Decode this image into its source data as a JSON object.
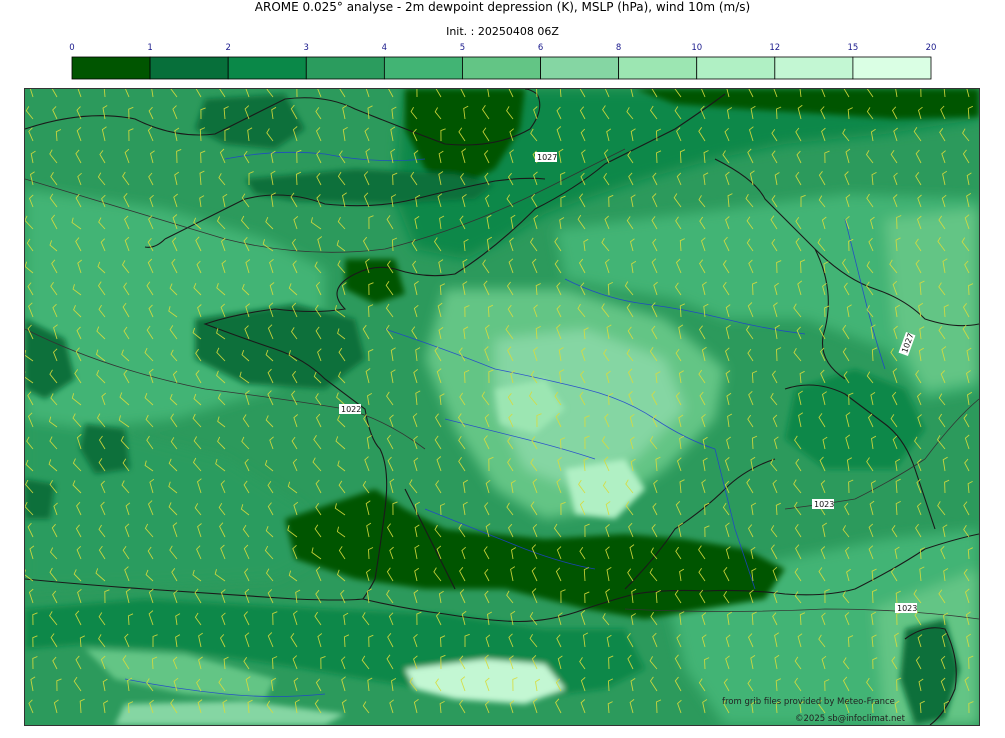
{
  "header": {
    "title": "AROME 0.025° analyse - 2m dewpoint depression (K), MSLP (hPa), wind 10m (m/s)",
    "subtitle": "Init. : 20250408 06Z"
  },
  "legend": {
    "ticks": [
      "0",
      "1",
      "2",
      "3",
      "4",
      "5",
      "6",
      "8",
      "10",
      "12",
      "15",
      "20"
    ],
    "colors": [
      "#005500",
      "#076f3a",
      "#0a8848",
      "#2b9c5e",
      "#42b474",
      "#63c585",
      "#85d6a3",
      "#9ce6b2",
      "#b0f0c4",
      "#c3f7d3",
      "#daffe4"
    ]
  },
  "map": {
    "isobar_labels": [
      "1027",
      "1027",
      "1022",
      "1023",
      "1023"
    ],
    "contour_color": "#1a1a1a",
    "river_color": "#1f3fd0",
    "wind_barb_color": "#d8dc3c",
    "credit_data": "from grib files provided by Meteo-France",
    "credit_copyright": "©2025 sb@infoclimat.net"
  }
}
